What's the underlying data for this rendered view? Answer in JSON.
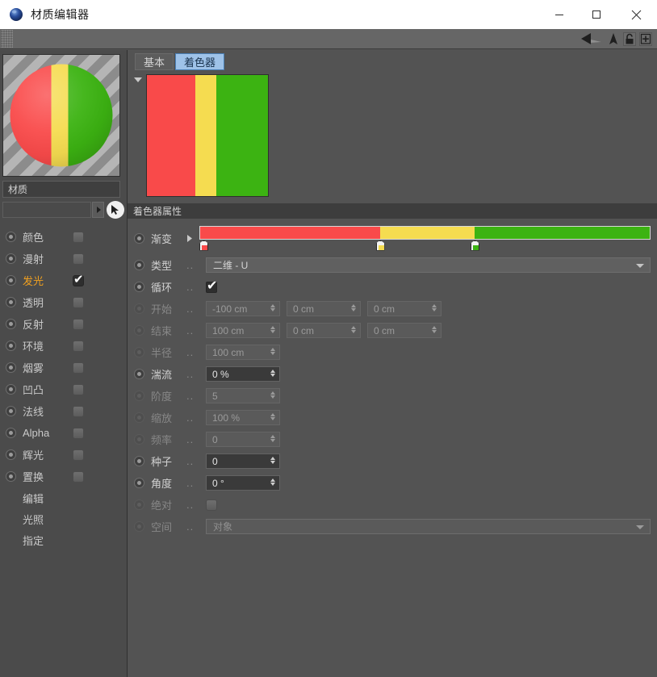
{
  "window": {
    "title": "材质编辑器",
    "app_icon": "material-sphere-icon",
    "minimize": "−",
    "maximize": "▢",
    "close": "✕"
  },
  "toolbar": {
    "grip": "drag-grip",
    "icons": [
      "back-arrow-icon",
      "up-arrow-icon",
      "lock-icon",
      "add-icon"
    ]
  },
  "left_panel": {
    "preview_label": "material-preview",
    "material_name": "材质",
    "texture_field_value": "",
    "texture_arrow": "▶",
    "cursor_icon": "pick-cursor-icon",
    "channels": [
      {
        "label": "颜色",
        "checked": false,
        "active": false
      },
      {
        "label": "漫射",
        "checked": false,
        "active": false
      },
      {
        "label": "发光",
        "checked": true,
        "active": true
      },
      {
        "label": "透明",
        "checked": false,
        "active": false
      },
      {
        "label": "反射",
        "checked": false,
        "active": false
      },
      {
        "label": "环境",
        "checked": false,
        "active": false
      },
      {
        "label": "烟雾",
        "checked": false,
        "active": false
      },
      {
        "label": "凹凸",
        "checked": false,
        "active": false
      },
      {
        "label": "法线",
        "checked": false,
        "active": false
      },
      {
        "label": "Alpha",
        "checked": false,
        "active": false
      },
      {
        "label": "辉光",
        "checked": false,
        "active": false
      },
      {
        "label": "置换",
        "checked": false,
        "active": false
      }
    ],
    "actions": [
      "编辑",
      "光照",
      "指定"
    ]
  },
  "right_panel": {
    "tabs": [
      {
        "label": "基本",
        "selected": false
      },
      {
        "label": "着色器",
        "selected": true
      }
    ],
    "properties_header": "着色器属性",
    "shader_preview": {
      "bands": [
        {
          "color": "#F94A4A",
          "width_pct": 40
        },
        {
          "color": "#F5DC50",
          "width_pct": 17
        },
        {
          "color": "#3CB312",
          "width_pct": 43
        }
      ]
    },
    "gradient": {
      "label": "渐变",
      "dots": "..",
      "expander": "▶",
      "segments": [
        {
          "color": "#F94A4A",
          "width_pct": 40
        },
        {
          "color": "#F5DC50",
          "width_pct": 21
        },
        {
          "color": "#3CB312",
          "width_pct": 39
        }
      ],
      "knots": [
        {
          "position_pct": 0,
          "color": "#F94A4A"
        },
        {
          "position_pct": 40,
          "color": "#F5DC50"
        },
        {
          "position_pct": 61,
          "color": "#3CB312"
        }
      ]
    },
    "rows": [
      {
        "label": "类型",
        "dots": "..",
        "enabled": true,
        "value": "二维 - U"
      },
      {
        "label": "循环",
        "dots": "..",
        "enabled": true,
        "checked": true
      },
      {
        "label": "开始",
        "dots": "..",
        "enabled": false,
        "values": [
          "-100 cm",
          "0 cm",
          "0 cm"
        ]
      },
      {
        "label": "结束",
        "dots": "..",
        "enabled": false,
        "values": [
          "100 cm",
          "0 cm",
          "0 cm"
        ]
      },
      {
        "label": "半径",
        "dots": "..",
        "enabled": false,
        "values": [
          "100 cm"
        ]
      },
      {
        "label": "湍流",
        "dots": "..",
        "enabled": true,
        "values": [
          "0 %"
        ]
      },
      {
        "label": "阶度",
        "dots": "..",
        "enabled": false,
        "values": [
          "5"
        ]
      },
      {
        "label": "缩放",
        "dots": "..",
        "enabled": false,
        "values": [
          "100 %"
        ]
      },
      {
        "label": "频率",
        "dots": "..",
        "enabled": false,
        "values": [
          "0"
        ]
      },
      {
        "label": "种子",
        "dots": "..",
        "enabled": true,
        "values": [
          "0"
        ]
      },
      {
        "label": "角度",
        "dots": "..",
        "enabled": true,
        "values": [
          "0 °"
        ]
      },
      {
        "label": "绝对",
        "dots": "..",
        "enabled": false,
        "checked": false
      },
      {
        "label": "空间",
        "dots": "..",
        "enabled": false,
        "value": "对象"
      }
    ]
  },
  "colors": {
    "red": "#F94A4A",
    "yellow": "#F5DC50",
    "green": "#3CB312",
    "accent_orange": "#F0A020",
    "tab_selected": "#9EC2E8",
    "panel_bg": "#535353",
    "left_bg": "#4B4B4B"
  }
}
